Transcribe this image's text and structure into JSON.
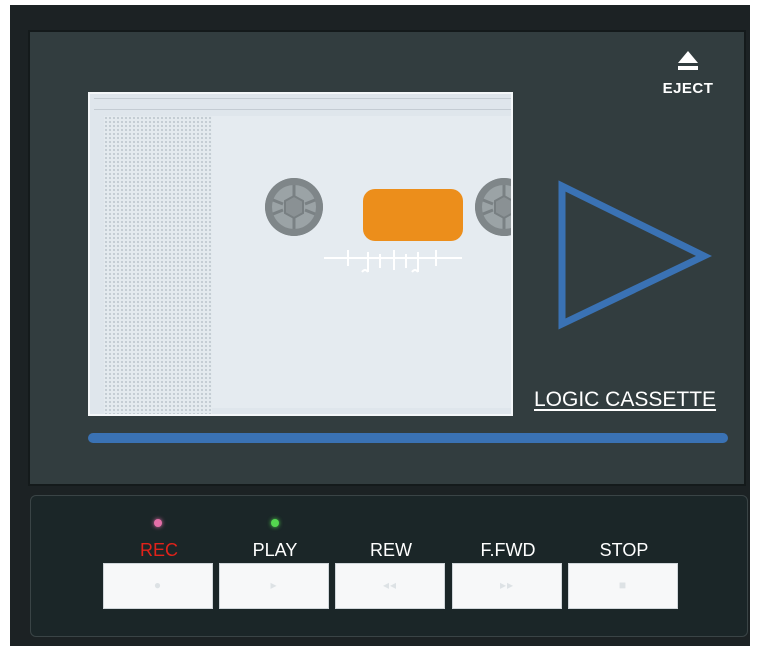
{
  "eject": {
    "label": "EJECT",
    "icon": "eject-icon"
  },
  "brand": "LOGIC CASSETTE",
  "colors": {
    "body": "#323d3f",
    "controls": "#1b2628",
    "window": "#ec8e1b",
    "tape_bar": "#3a72b4",
    "arrow": "#3a72b4",
    "rec_label": "#e1221a",
    "rec_led": "#e46fa8",
    "play_led": "#54d64f"
  },
  "cassette": {
    "reel_icon": "reel-icon",
    "window": "tape-window"
  },
  "play_indicator": {
    "icon": "play-triangle-icon"
  },
  "controls": {
    "rec": {
      "label": "REC",
      "glyph": "●",
      "icon": "record-icon"
    },
    "play": {
      "label": "PLAY",
      "glyph": "▸",
      "icon": "play-icon"
    },
    "rew": {
      "label": "REW",
      "glyph": "◂◂",
      "icon": "rewind-icon"
    },
    "ffwd": {
      "label": "F.FWD",
      "glyph": "▸▸",
      "icon": "fast-forward-icon"
    },
    "stop": {
      "label": "STOP",
      "glyph": "■",
      "icon": "stop-icon"
    }
  }
}
